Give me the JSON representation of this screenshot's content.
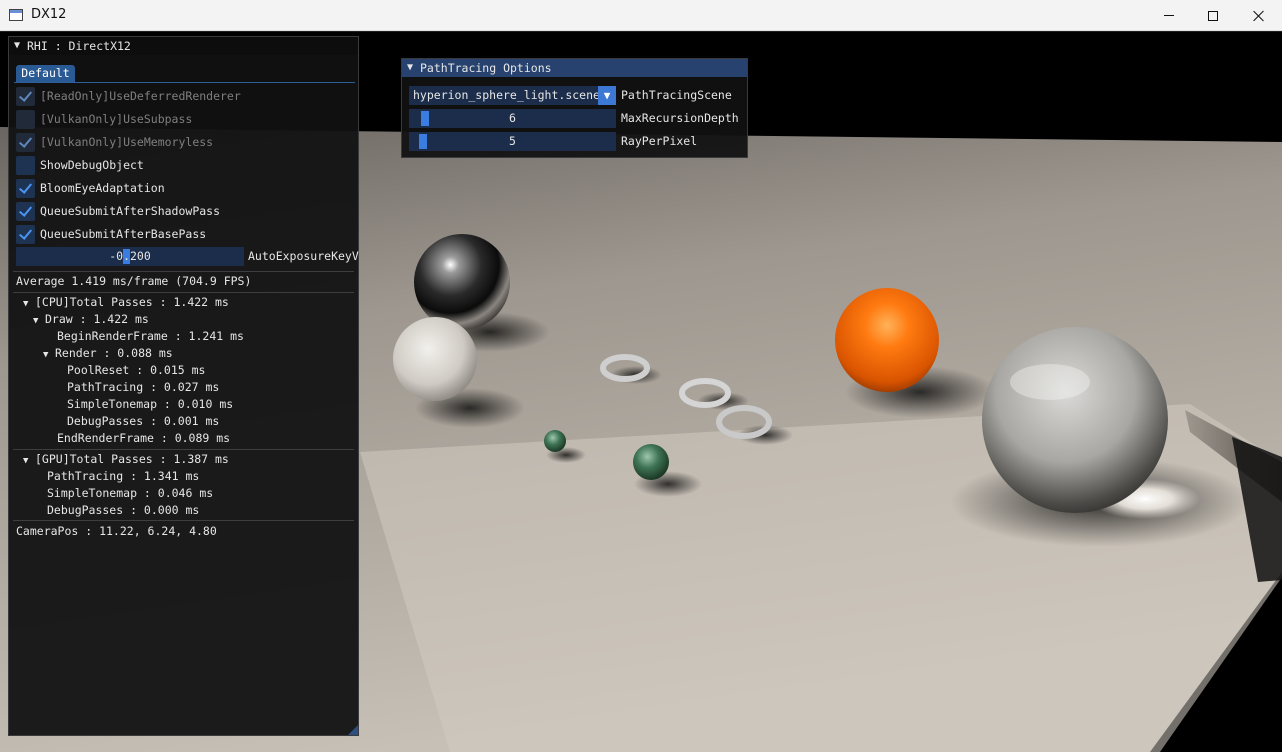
{
  "window": {
    "title": "DX12"
  },
  "rhi_panel": {
    "title": "RHI : DirectX12",
    "tab": "Default",
    "checkboxes": [
      {
        "label": "[ReadOnly]UseDeferredRenderer",
        "checked": true,
        "disabled": true
      },
      {
        "label": "[VulkanOnly]UseSubpass",
        "checked": false,
        "disabled": true
      },
      {
        "label": "[VulkanOnly]UseMemoryless",
        "checked": true,
        "disabled": true
      },
      {
        "label": "ShowDebugObject",
        "checked": false,
        "disabled": false
      },
      {
        "label": "BloomEyeAdaptation",
        "checked": true,
        "disabled": false
      },
      {
        "label": "QueueSubmitAfterShadowPass",
        "checked": true,
        "disabled": false
      },
      {
        "label": "QueueSubmitAfterBasePass",
        "checked": true,
        "disabled": false
      }
    ],
    "exposure": {
      "value": "-0.200",
      "label": "AutoExposureKeyV"
    },
    "average": "Average 1.419 ms/frame (704.9 FPS)",
    "cpu": {
      "total": "[CPU]Total Passes : 1.422 ms",
      "draw": "Draw : 1.422 ms",
      "begin_render_frame": "BeginRenderFrame : 1.241 ms",
      "render": "Render : 0.088 ms",
      "pool_reset": "PoolReset : 0.015 ms",
      "path_tracing": "PathTracing : 0.027 ms",
      "simple_tonemap": "SimpleTonemap : 0.010 ms",
      "debug_passes": "DebugPasses : 0.001 ms",
      "end_render_frame": "EndRenderFrame : 0.089 ms"
    },
    "gpu": {
      "total": "[GPU]Total Passes : 1.387 ms",
      "path_tracing": "PathTracing : 1.341 ms",
      "simple_tonemap": "SimpleTonemap : 0.046 ms",
      "debug_passes": "DebugPasses : 0.000 ms"
    },
    "camera_pos": "CameraPos : 11.22, 6.24, 4.80"
  },
  "pathtracing_panel": {
    "title": "PathTracing Options",
    "scene_value": "hyperion_sphere_light.scene",
    "scene_label": "PathTracingScene",
    "max_recursion": {
      "value": "6",
      "label": "MaxRecursionDepth"
    },
    "ray_per_pixel": {
      "value": "5",
      "label": "RayPerPixel"
    }
  },
  "icons": {
    "collapse_arrow": "▼",
    "combo_arrow": "▼"
  }
}
